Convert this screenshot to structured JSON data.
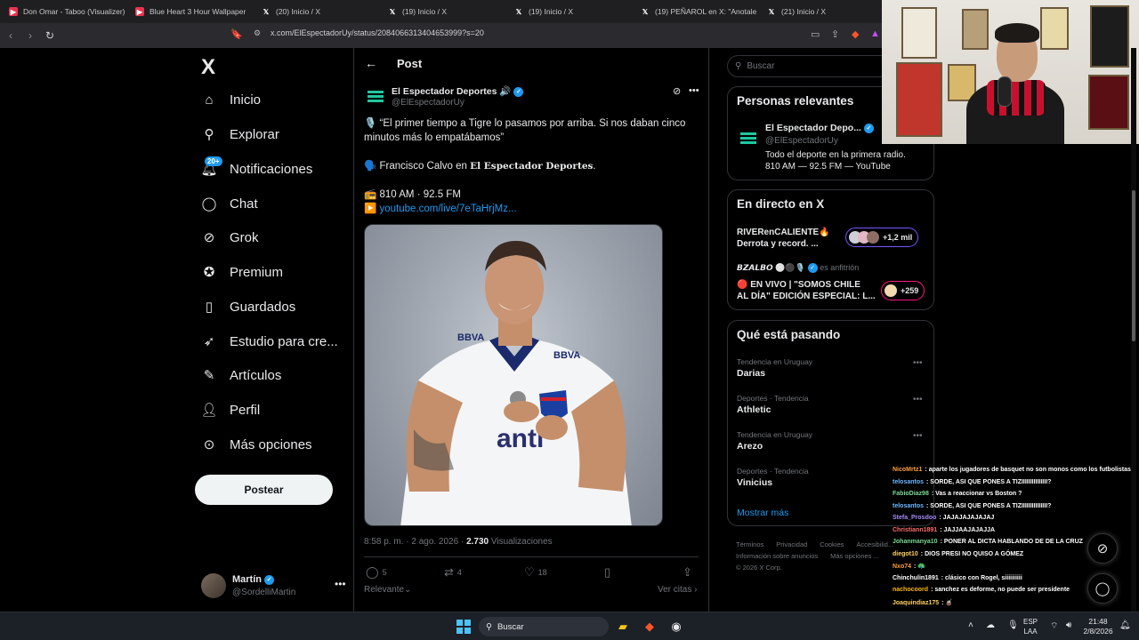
{
  "browser": {
    "tabs": [
      {
        "icon": "youtube-icon",
        "title": "Don Omar - Taboo (Visualizer)"
      },
      {
        "icon": "youtube-icon",
        "title": "Blue Heart 3 Hour Wallpaper"
      },
      {
        "icon": "x-icon",
        "title": "(20) Inicio / X"
      },
      {
        "icon": "x-icon",
        "title": "(19) Inicio / X"
      },
      {
        "icon": "x-icon",
        "title": "(19) Inicio / X"
      },
      {
        "icon": "x-icon",
        "title": "(19) PEÑAROL en X: \"Anotale a"
      },
      {
        "icon": "x-icon",
        "title": "(21) Inicio / X"
      }
    ],
    "url": "x.com/ElEspectadorUy/status/2084066313404653999?s=20"
  },
  "nav": {
    "logo": "X",
    "items": [
      {
        "icon": "home-icon",
        "label": "Inicio"
      },
      {
        "icon": "search-icon",
        "label": "Explorar"
      },
      {
        "icon": "bell-icon",
        "label": "Notificaciones",
        "badge": "20+"
      },
      {
        "icon": "chat-icon",
        "label": "Chat"
      },
      {
        "icon": "grok-icon",
        "label": "Grok"
      },
      {
        "icon": "premium-icon",
        "label": "Premium"
      },
      {
        "icon": "bookmark-icon",
        "label": "Guardados"
      },
      {
        "icon": "rocket-icon",
        "label": "Estudio para cre..."
      },
      {
        "icon": "article-icon",
        "label": "Artículos"
      },
      {
        "icon": "profile-icon",
        "label": "Perfil"
      },
      {
        "icon": "more-icon",
        "label": "Más opciones"
      }
    ],
    "post_button": "Postear",
    "account": {
      "name": "Martín",
      "handle": "@SordelliMartin"
    }
  },
  "post": {
    "header_title": "Post",
    "author_name": "El Espectador Deportes",
    "author_handle": "@ElEspectadorUy",
    "line1": "🎙️ “El primer tiempo a Tigre lo pasamos por arriba. Si nos daban cinco",
    "line2": "minutos más lo empatábamos”",
    "credit_prefix": "🗣️ Francisco Calvo en ",
    "credit_name": "El Espectador Deportes",
    "credit_suffix": ".",
    "radio": "📻 810 AM · 92.5 FM",
    "link_prefix": "▶️ ",
    "link": "youtube.com/live/7eTaHrjMz...",
    "timestamp": "8:58 p. m. · 2 ago. 2026 · ",
    "views_count": "2.730",
    "views_label": " Visualizaciones",
    "replies": "5",
    "reposts": "4",
    "likes": "18",
    "sort_label": "Relevante",
    "quotes_link": "Ver citas"
  },
  "sidebar": {
    "search_placeholder": "Buscar",
    "relevant_title": "Personas relevantes",
    "relevant_name": "El Espectador Depo...",
    "relevant_handle": "@ElEspectadorUy",
    "relevant_bio_1": "Todo el deporte en la primera radio.",
    "relevant_bio_2": "810 AM — 92.5 FM — YouTube",
    "live_title": "En directo en X",
    "live1_title_1": "RIVERenCALIENTE🔥",
    "live1_title_2": "Derrota y record. ...",
    "live1_count": "+1,2 mil",
    "live2_host_name": "𝘽𝙕𝘼𝙇𝘽𝙊",
    "live2_host_suffix": "es anfitrión",
    "live2_title_1": "🔴 EN VIVO | \"SOMOS CHILE",
    "live2_title_2": "AL DÍA\" EDICIÓN ESPECIAL: L...",
    "live2_count": "+259",
    "trends_title": "Qué está pasando",
    "trends": [
      {
        "category": "Tendencia en Uruguay",
        "name": "Darias"
      },
      {
        "category": "Deportes · Tendencia",
        "name": "Athletic"
      },
      {
        "category": "Tendencia en Uruguay",
        "name": "Arezo"
      },
      {
        "category": "Deportes · Tendencia",
        "name": "Vinicius"
      }
    ],
    "show_more": "Mostrar más",
    "footer_1": "Términos",
    "footer_2": "Privacidad",
    "footer_3": "Cookies",
    "footer_4": "Accesibilid...",
    "footer_5": "Información sobre anuncios",
    "footer_6": "Más opciones ...",
    "copyright": "© 2026 X Corp."
  },
  "chat": [
    {
      "user": "NicoMrtz1",
      "user_color": "#ff9f3d",
      "text": ": aparte los jugadores de basquet no son monos como los futbolistas"
    },
    {
      "user": "telosantos",
      "user_color": "#6fb7ff",
      "text": ": SORDE, ASI QUE PONES A TIZIIIIIIIIIIIIIII?"
    },
    {
      "user": "FabioDiaz98",
      "user_color": "#7cd992",
      "text": ": Vas a reaccionar vs Boston ?"
    },
    {
      "user": "telosantos",
      "user_color": "#6fb7ff",
      "text": ": SORDE, ASI QUE PONES A TIZIIIIIIIIIIIIIII?"
    },
    {
      "user": "Stefa_Prosdoo",
      "user_color": "#a78bfa",
      "text": ": JAJAJAJAJAJAJ"
    },
    {
      "user": "Christiann1891",
      "user_color": "#ff6b6b",
      "text": ": JAJJAAJAJAJJA"
    },
    {
      "user": "Johanmanya10",
      "user_color": "#7cd992",
      "text": ": PONER AL DICTA HABLANDO DE DE LA CRUZ"
    },
    {
      "user": "diegot10",
      "user_color": "#ffd166",
      "text": ": DIOS PRESI NO QUISO A GÓMEZ"
    },
    {
      "user": "Nxo74",
      "user_color": "#ff9f3d",
      "text": ": 🦚"
    },
    {
      "user": "Chinchulin1891",
      "user_color": "#ffffff",
      "text": ": clásico con Rogel, siiiiiiiiii"
    },
    {
      "user": "nachocoord",
      "user_color": "#ffb703",
      "text": ": sanchez es deforme, no puede ser presidente"
    },
    {
      "user": "Joaquindiaz175",
      "user_color": "#ffd166",
      "text": ": 🧉"
    }
  ],
  "taskbar": {
    "search": "Buscar",
    "lang_1": "ESP",
    "lang_2": "LAA",
    "time": "21:48",
    "date": "2/8/2026"
  },
  "colors": {
    "accent": "#1d9bf0",
    "background": "#000000",
    "live_ring": "#7856ff"
  }
}
